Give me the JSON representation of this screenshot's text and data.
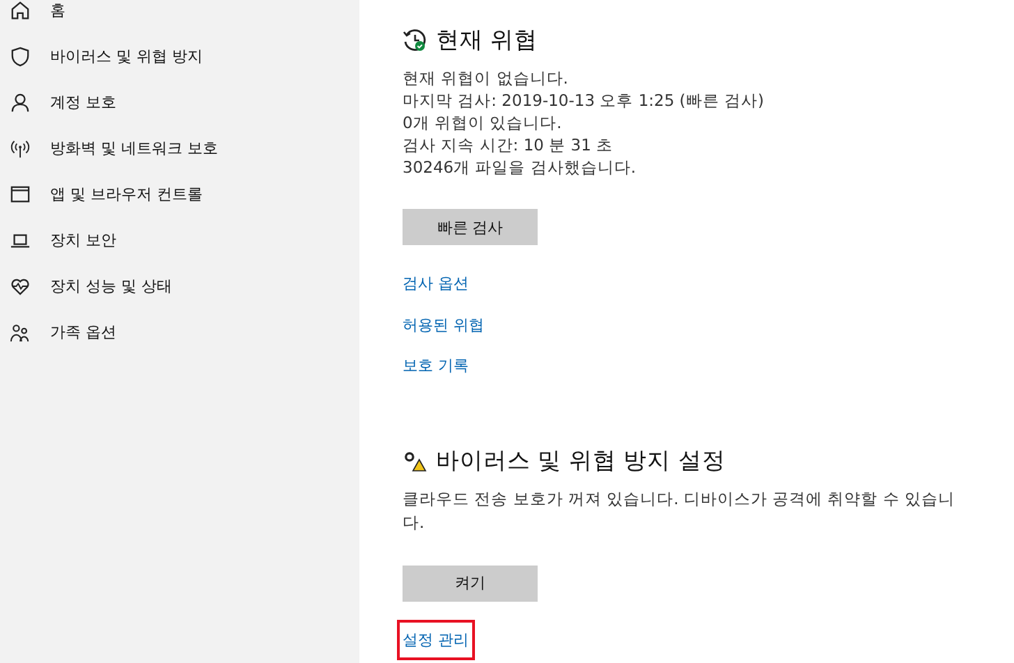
{
  "sidebar": {
    "items": [
      {
        "kind": "home",
        "label": "홈"
      },
      {
        "kind": "shield",
        "label": "바이러스 및 위협 방지"
      },
      {
        "kind": "person",
        "label": "계정 보호"
      },
      {
        "kind": "antenna",
        "label": "방화벽 및 네트워크 보호"
      },
      {
        "kind": "window",
        "label": "앱 및 브라우저 컨트롤"
      },
      {
        "kind": "laptop",
        "label": "장치 보안"
      },
      {
        "kind": "heart",
        "label": "장치 성능 및 상태"
      },
      {
        "kind": "family",
        "label": "가족 옵션"
      }
    ]
  },
  "sections": [
    {
      "kind": "ok",
      "title": "현재 위협",
      "lines": [
        "현재 위협이 없습니다.",
        "마지막 검사: 2019-10-13 오후 1:25 (빠른 검사)",
        "0개 위협이 있습니다.",
        "검사 지속 시간: 10 분 31 초",
        "30246개 파일을 검사했습니다."
      ],
      "button": "빠른 검사",
      "links": [
        {
          "label": "검사 옵션",
          "highlighted": false
        },
        {
          "label": "허용된 위협",
          "highlighted": false
        },
        {
          "label": "보호 기록",
          "highlighted": false
        }
      ]
    },
    {
      "kind": "warning",
      "title": "바이러스 및 위협 방지 설정",
      "lines": [
        "클라우드 전송 보호가 꺼져 있습니다. 디바이스가 공격에 취약할 수 있습니다."
      ],
      "button": "켜기",
      "links": [
        {
          "label": "설정 관리",
          "highlighted": true
        }
      ]
    }
  ]
}
